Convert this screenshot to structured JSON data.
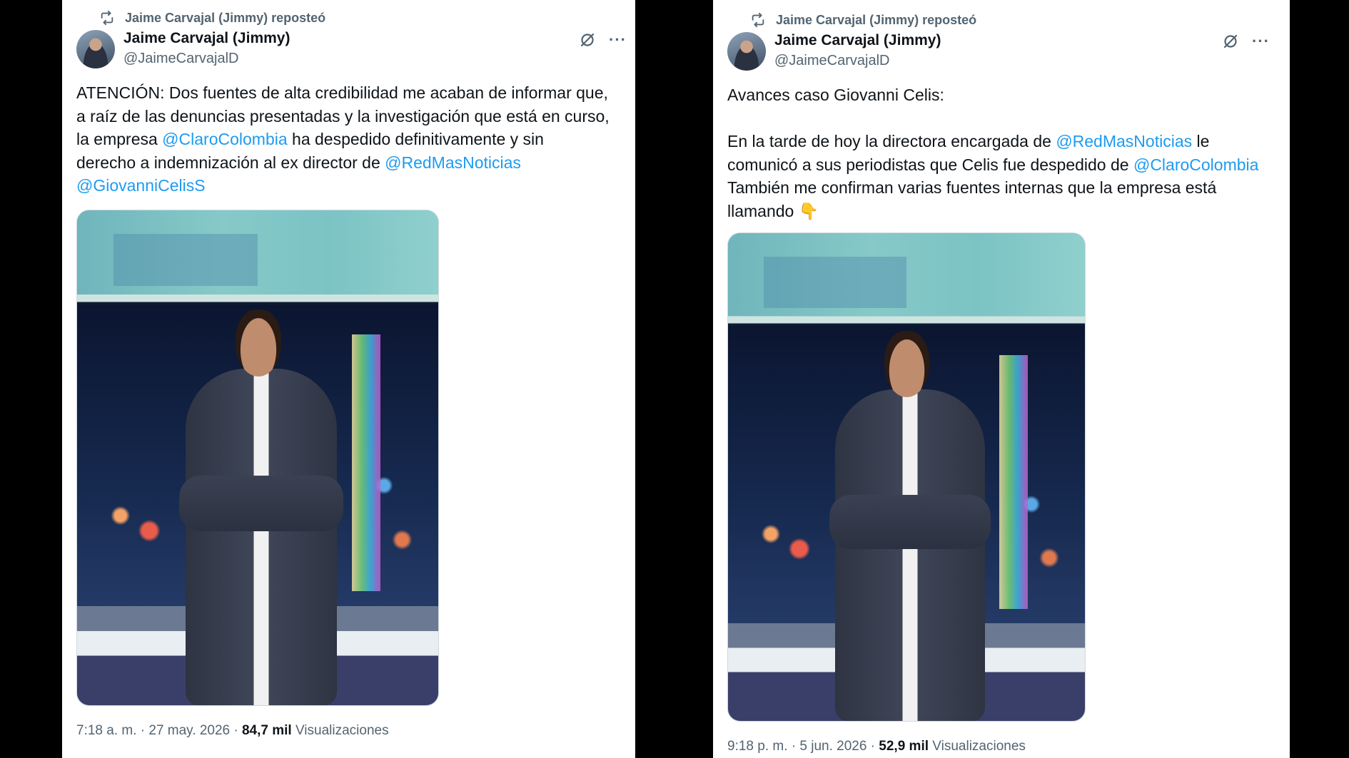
{
  "tweets": [
    {
      "repost_label": "Jaime Carvajal (Jimmy) reposteó",
      "author_name": "Jaime Carvajal (Jimmy)",
      "author_handle": "@JaimeCarvajalD",
      "text_lines": [
        [
          {
            "t": "ATENCIÓN: Dos fuentes de alta credibilidad me acaban de informar que,"
          }
        ],
        [
          {
            "t": "a raíz de las denuncias presentadas y la investigación que está en curso,"
          }
        ],
        [
          {
            "t": "la empresa "
          },
          {
            "t": "@ClaroColombia",
            "m": true
          },
          {
            "t": " ha despedido definitivamente y sin"
          }
        ],
        [
          {
            "t": "derecho a indemnización al ex director de "
          },
          {
            "t": "@RedMasNoticias",
            "m": true
          }
        ],
        [
          {
            "t": "@GiovanniCelisS",
            "m": true
          }
        ]
      ],
      "timestamp": "7:18 a. m. · 27 may. 2026 · ",
      "views_count": "84,7 mil",
      "views_label": " Visualizaciones"
    },
    {
      "repost_label": "Jaime Carvajal (Jimmy) reposteó",
      "author_name": "Jaime Carvajal (Jimmy)",
      "author_handle": "@JaimeCarvajalD",
      "text_lines": [
        [
          {
            "t": "Avances caso Giovanni Celis:"
          }
        ],
        [],
        [
          {
            "t": "En la tarde de hoy la directora encargada de "
          },
          {
            "t": "@RedMasNoticias",
            "m": true
          },
          {
            "t": " le"
          }
        ],
        [
          {
            "t": "comunicó a sus periodistas que Celis fue despedido de "
          },
          {
            "t": "@ClaroColombia",
            "m": true
          }
        ],
        [
          {
            "t": "También me confirman varias fuentes internas que la empresa está"
          }
        ],
        [
          {
            "t": "llamando 👇"
          }
        ]
      ],
      "timestamp": "9:18 p. m. · 5 jun. 2026 · ",
      "views_count": "52,9 mil",
      "views_label": " Visualizaciones"
    }
  ],
  "icons": {
    "repost": "repost-icon",
    "grok": "grok-icon",
    "more": "more-icon"
  },
  "colors": {
    "mention": "#1d9bf0",
    "secondary_text": "#536471",
    "primary_text": "#0f1419",
    "background": "#000000"
  }
}
